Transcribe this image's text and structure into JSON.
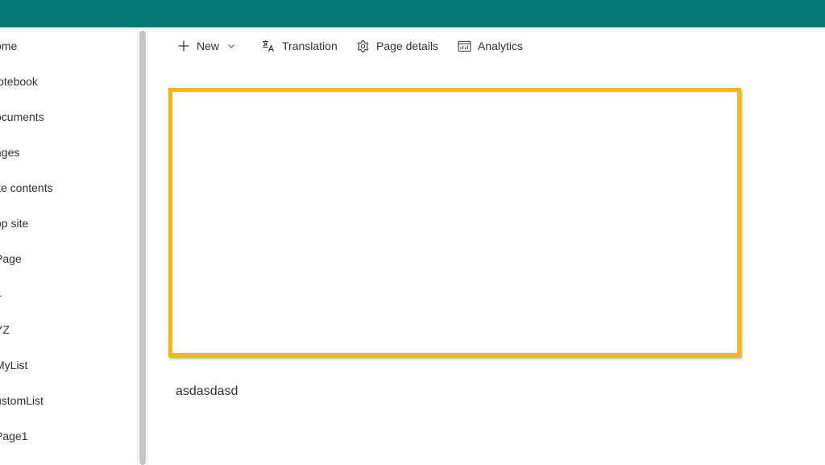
{
  "nav": {
    "items": [
      {
        "label": "ome"
      },
      {
        "label": "lotebook"
      },
      {
        "label": "ocuments"
      },
      {
        "label": "ages"
      },
      {
        "label": "ite contents"
      },
      {
        "label": "op site"
      },
      {
        "label": "Page"
      },
      {
        "label": "4"
      },
      {
        "label": "YZ"
      },
      {
        "label": "MyList"
      },
      {
        "label": "ustomList"
      },
      {
        "label": "Page1"
      }
    ]
  },
  "commandbar": {
    "new_label": "New",
    "translation_label": "Translation",
    "page_details_label": "Page details",
    "analytics_label": "Analytics"
  },
  "content": {
    "text": "asdasdasd"
  },
  "colors": {
    "topbar": "#077878",
    "highlight_border": "#f0b81e"
  }
}
